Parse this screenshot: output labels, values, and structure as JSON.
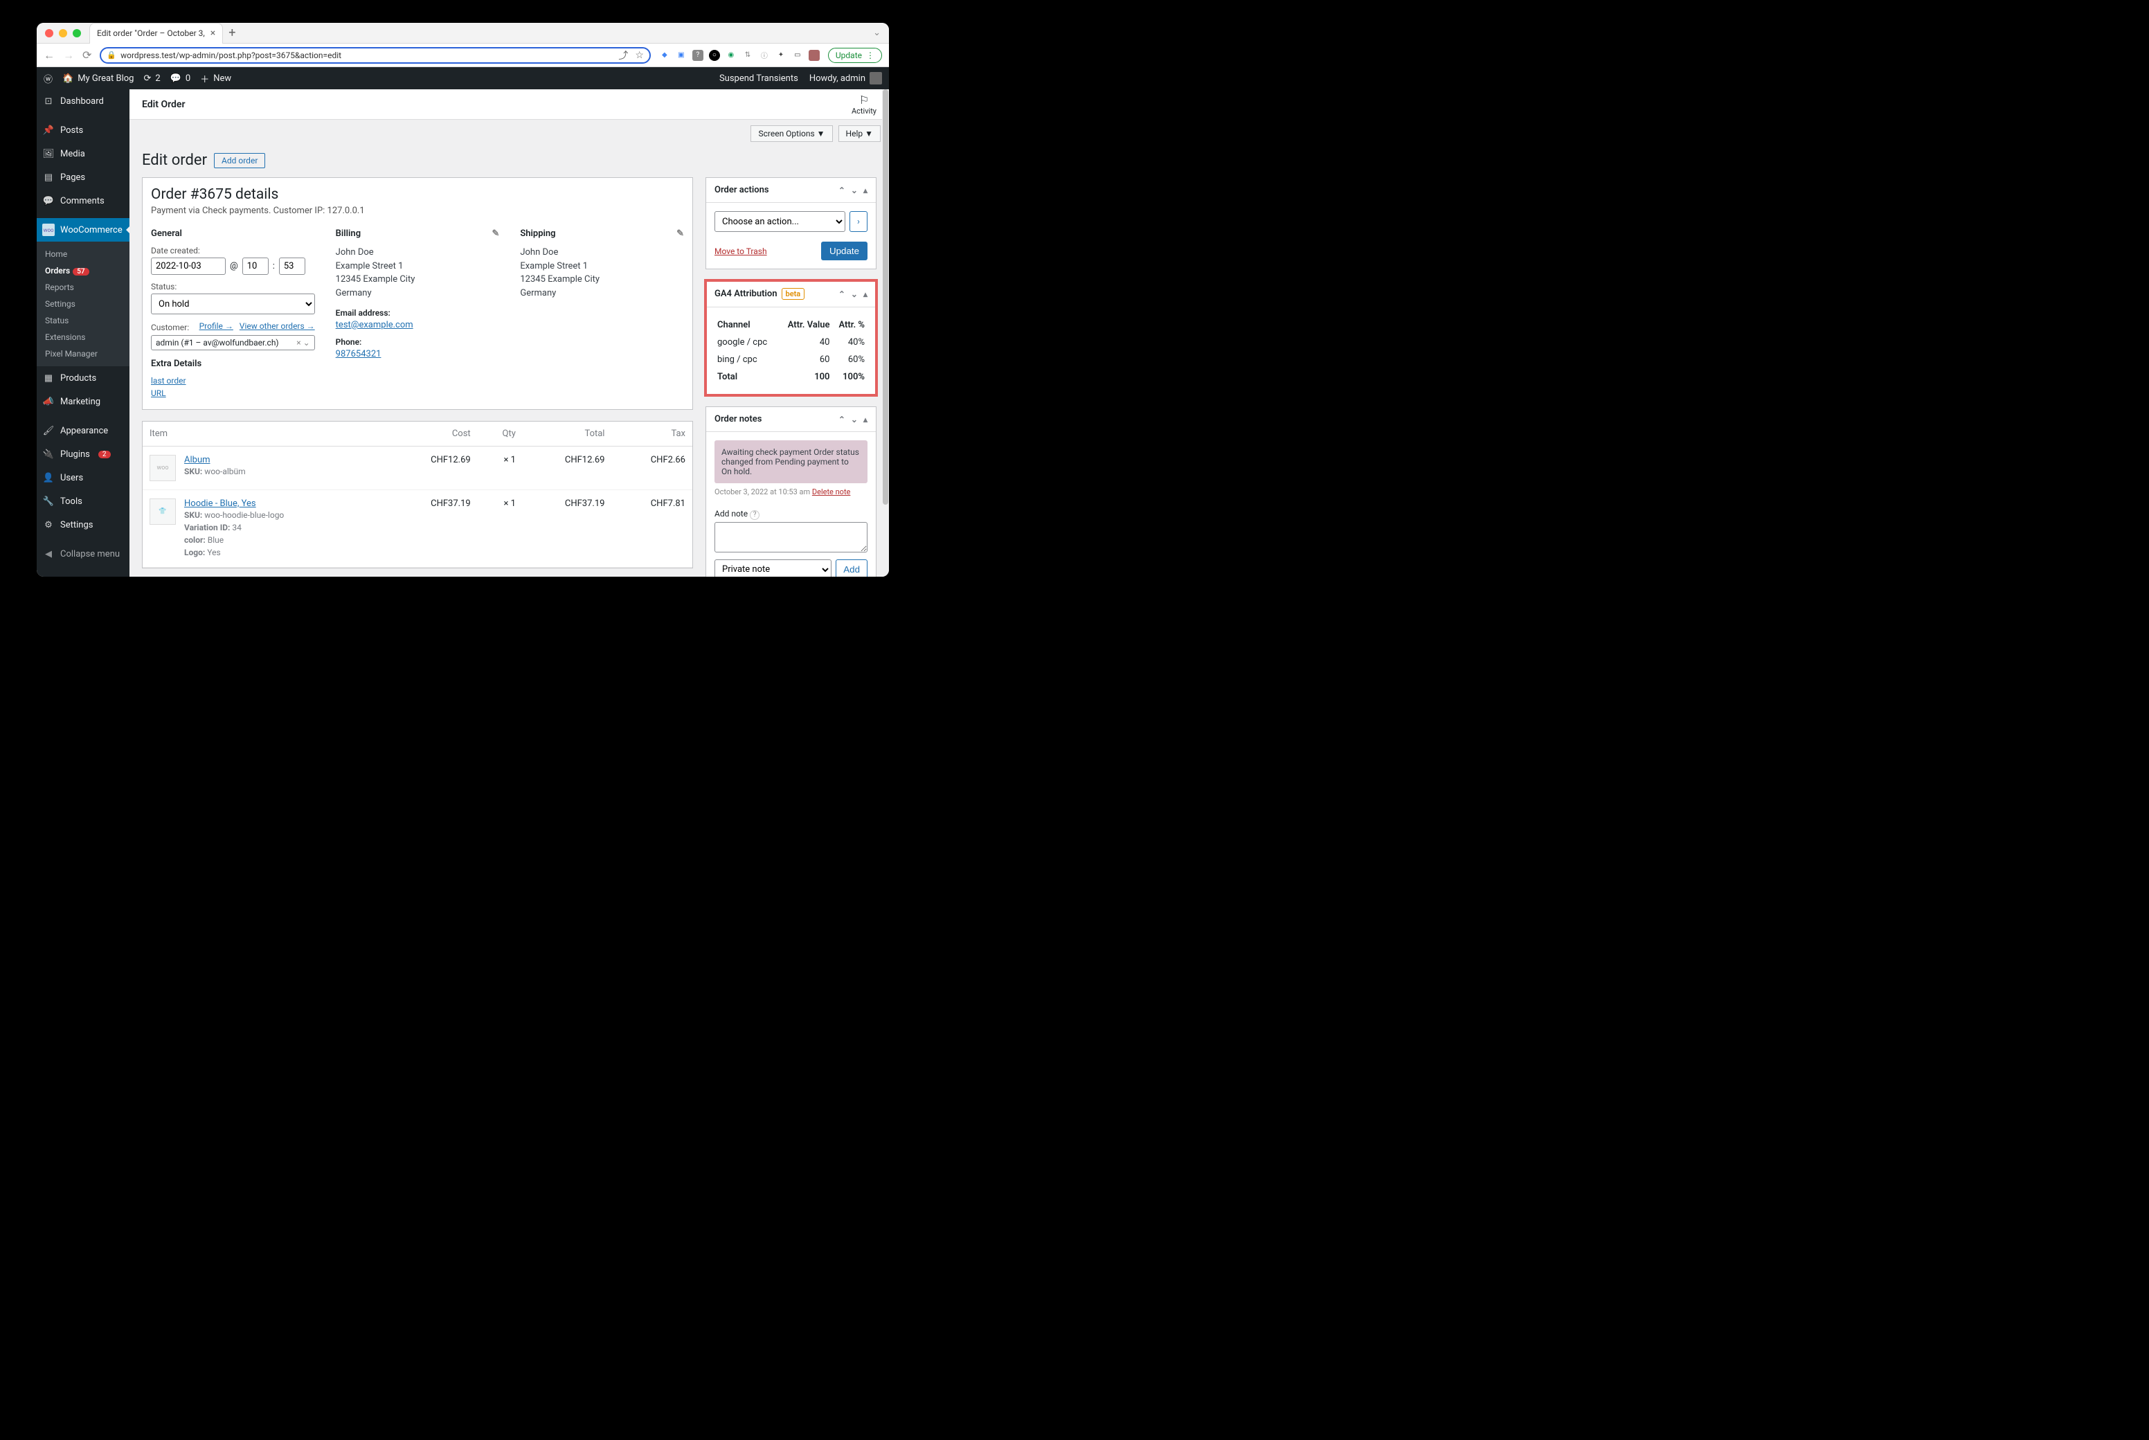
{
  "browser": {
    "tab_title": "Edit order \"Order – October 3,",
    "url": "wordpress.test/wp-admin/post.php?post=3675&action=edit",
    "update_label": "Update"
  },
  "adminbar": {
    "site": "My Great Blog",
    "updates": "2",
    "comments": "0",
    "new": "New",
    "suspend": "Suspend Transients",
    "howdy": "Howdy, admin"
  },
  "sidebar": {
    "dashboard": "Dashboard",
    "posts": "Posts",
    "media": "Media",
    "pages": "Pages",
    "comments": "Comments",
    "woocommerce": "WooCommerce",
    "sub_home": "Home",
    "sub_orders": "Orders",
    "orders_count": "57",
    "sub_reports": "Reports",
    "sub_settings": "Settings",
    "sub_status": "Status",
    "sub_extensions": "Extensions",
    "sub_pixel": "Pixel Manager",
    "products": "Products",
    "marketing": "Marketing",
    "appearance": "Appearance",
    "plugins": "Plugins",
    "plugins_count": "2",
    "users": "Users",
    "tools": "Tools",
    "settings": "Settings",
    "collapse": "Collapse menu"
  },
  "head": {
    "title": "Edit Order",
    "activity": "Activity",
    "screen_options": "Screen Options",
    "help": "Help",
    "page_title": "Edit order",
    "add_order": "Add order"
  },
  "order": {
    "title": "Order #3675 details",
    "sub": "Payment via Check payments. Customer IP: 127.0.0.1",
    "general": "General",
    "date_label": "Date created:",
    "date": "2022-10-03",
    "at": "@",
    "hour": "10",
    "colon": ":",
    "minute": "53",
    "status_label": "Status:",
    "status": "On hold",
    "customer_label": "Customer:",
    "profile": "Profile →",
    "other_orders": "View other orders →",
    "customer": "admin (#1 – av@wolfundbaer.ch)",
    "extra": "Extra Details",
    "last_order": "last order",
    "url": "URL",
    "billing": "Billing",
    "bill_name": "John Doe",
    "bill_street": "Example Street 1",
    "bill_city": "12345 Example City",
    "bill_country": "Germany",
    "email_label": "Email address:",
    "email": "test@example.com",
    "phone_label": "Phone:",
    "phone": "987654321",
    "shipping": "Shipping",
    "ship_name": "John Doe",
    "ship_street": "Example Street 1",
    "ship_city": "12345 Example City",
    "ship_country": "Germany"
  },
  "items": {
    "h_item": "Item",
    "h_cost": "Cost",
    "h_qty": "Qty",
    "h_total": "Total",
    "h_tax": "Tax",
    "row1": {
      "name": "Album",
      "sku_label": "SKU:",
      "sku": "woo-albüm",
      "cost": "CHF12.69",
      "qty": "× 1",
      "total": "CHF12.69",
      "tax": "CHF2.66"
    },
    "row2": {
      "name": "Hoodie - Blue, Yes",
      "sku_label": "SKU:",
      "sku": "woo-hoodie-blue-logo",
      "var_label": "Variation ID:",
      "var": "34",
      "color_label": "color:",
      "color": "Blue",
      "logo_label": "Logo:",
      "logo": "Yes",
      "cost": "CHF37.19",
      "qty": "× 1",
      "total": "CHF37.19",
      "tax": "CHF7.81"
    }
  },
  "actions": {
    "title": "Order actions",
    "choose": "Choose an action...",
    "trash": "Move to Trash",
    "update": "Update"
  },
  "ga4": {
    "title": "GA4 Attribution",
    "beta": "beta",
    "h_channel": "Channel",
    "h_value": "Attr. Value",
    "h_pct": "Attr. %",
    "rows": [
      {
        "channel": "google / cpc",
        "value": "40",
        "pct": "40%"
      },
      {
        "channel": "bing / cpc",
        "value": "60",
        "pct": "60%"
      }
    ],
    "total_label": "Total",
    "total_value": "100",
    "total_pct": "100%"
  },
  "notes": {
    "title": "Order notes",
    "note1": "Awaiting check payment Order status changed from Pending payment to On hold.",
    "note1_time": "October 3, 2022 at 10:53 am",
    "delete": "Delete note",
    "add_label": "Add note",
    "type": "Private note",
    "add_btn": "Add"
  }
}
